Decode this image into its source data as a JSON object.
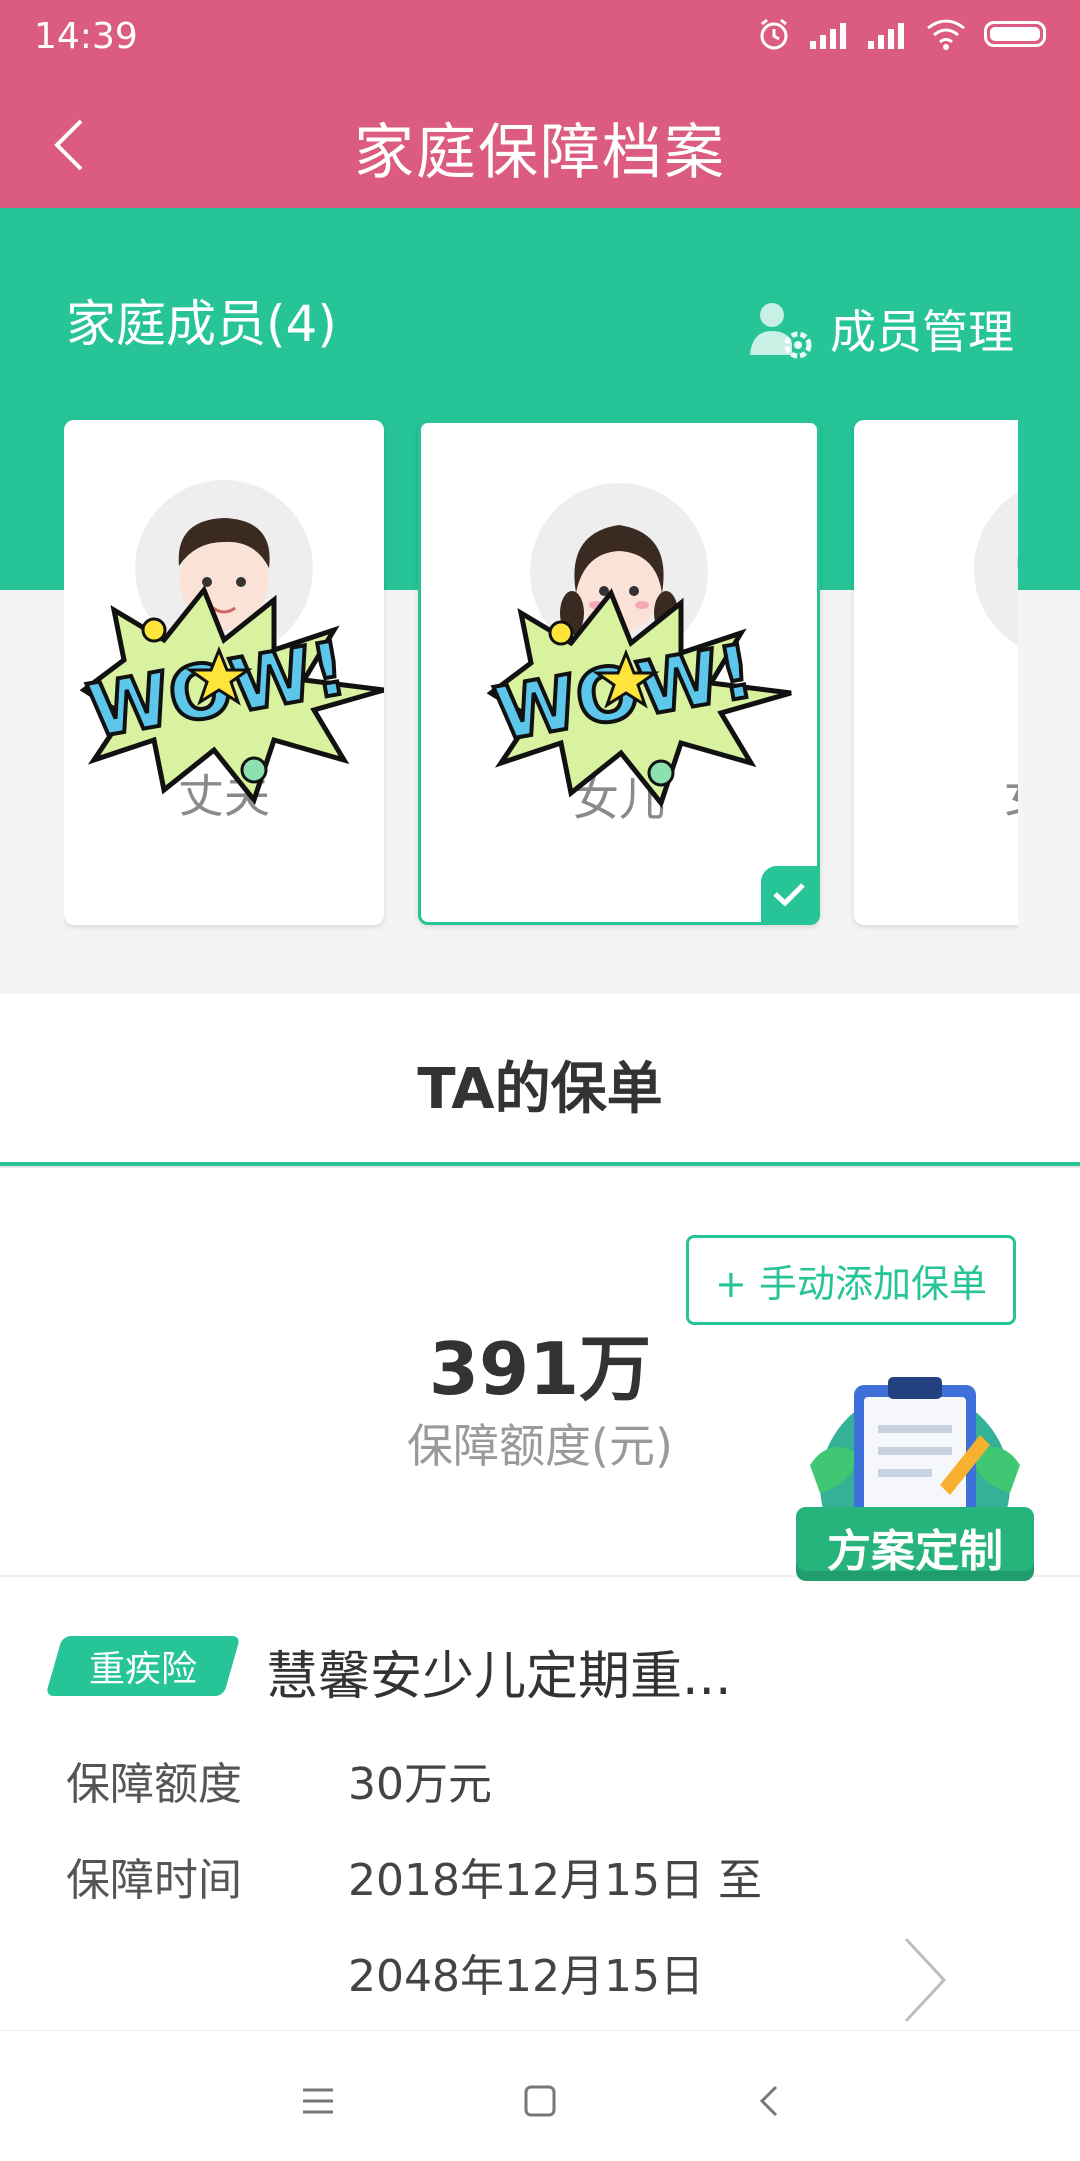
{
  "status": {
    "time": "14:39"
  },
  "header": {
    "title": "家庭保障档案",
    "back_icon": "chevron-left-icon"
  },
  "members": {
    "title": "家庭成员(4)",
    "manage_label": "成员管理",
    "cards": [
      {
        "name": "丈夫",
        "selected": false
      },
      {
        "name": "女儿",
        "selected": true
      },
      {
        "name": "女",
        "selected": false
      }
    ]
  },
  "policies": {
    "tab_title": "TA的保单",
    "add_button": "+ 手动添加保单",
    "total_amount": "391万",
    "total_label": "保障额度(元)",
    "custom_plan_label": "方案定制",
    "items": [
      {
        "tag": "重疾险",
        "name": "慧馨安少儿定期重...",
        "amount_label": "保障额度",
        "amount_value": "30万元",
        "period_label": "保障时间",
        "period_start": "2018年12月15日 至",
        "period_end": "2048年12月15日"
      }
    ]
  },
  "sticker_text": "WOW!",
  "colors": {
    "header": "#dc5b80",
    "accent": "#26c497",
    "background": "#f4f4f4"
  },
  "nav": {
    "icons": [
      "menu-icon",
      "home-square-icon",
      "back-triangle-icon"
    ]
  }
}
